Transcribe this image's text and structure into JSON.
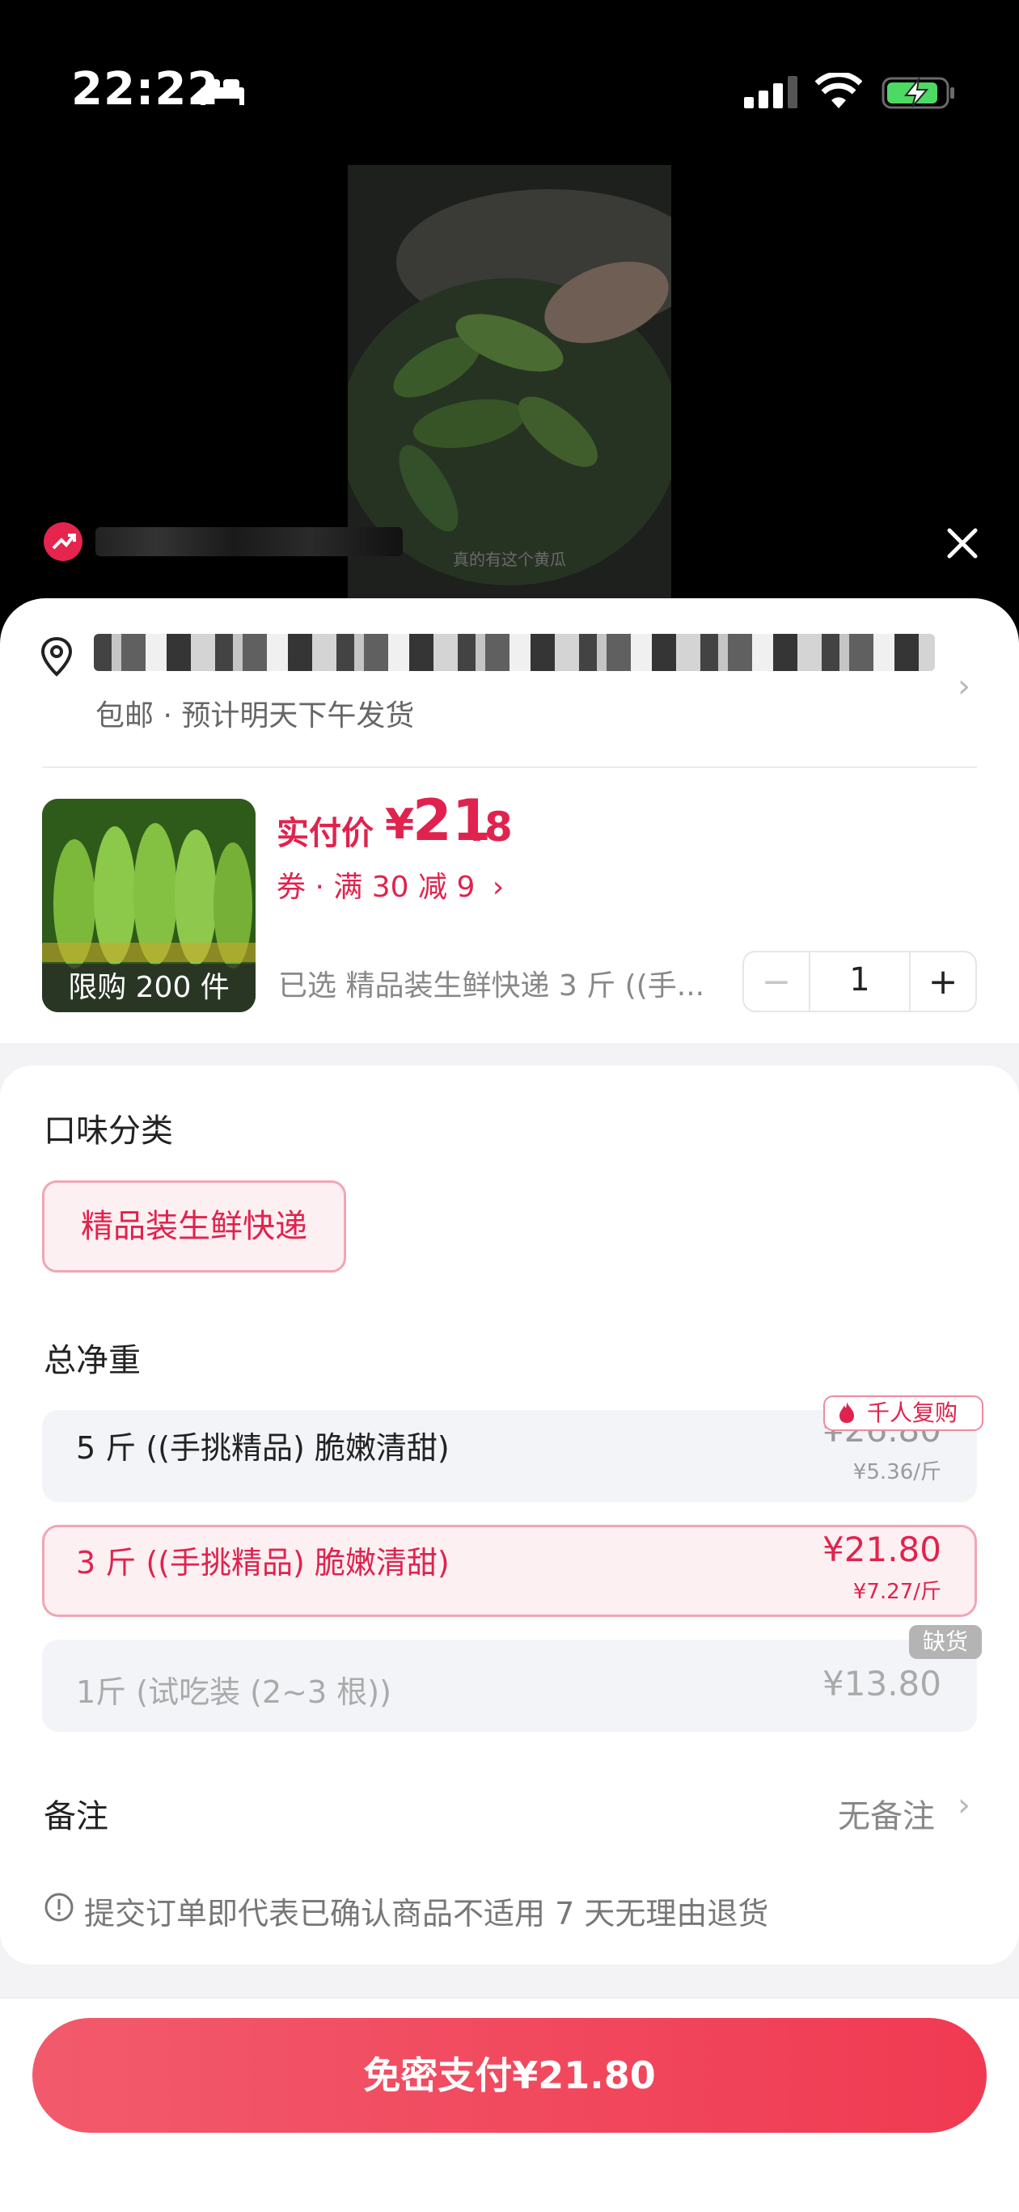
{
  "status_bar": {
    "time": "22:22"
  },
  "video": {
    "caption": "真的有这个黄瓜"
  },
  "address": {
    "shipping_note": "包邮 · 预计明天下午发货"
  },
  "product": {
    "price_label": "实付价",
    "price_symbol": "¥",
    "price_integer": "21",
    "price_decimal": ".8",
    "coupon_text": "券 · 满 30 减 9",
    "limit_text": "限购 200 件",
    "selected_text": "已选 精品装生鲜快递 3 斤 ((手...",
    "quantity": "1"
  },
  "flavor": {
    "title": "口味分类",
    "options": [
      "精品装生鲜快递"
    ]
  },
  "weight": {
    "title": "总净重",
    "options": [
      {
        "label": "5 斤 ((手挑精品) 脆嫩清甜)",
        "price": "¥26.80",
        "unit_price": "¥5.36/斤",
        "badge": "千人复购",
        "state": "normal"
      },
      {
        "label": "3 斤 ((手挑精品) 脆嫩清甜)",
        "price": "¥21.80",
        "unit_price": "¥7.27/斤",
        "state": "selected"
      },
      {
        "label": "1斤 (试吃装 (2~3 根))",
        "price": "¥13.80",
        "badge": "缺货",
        "state": "out_of_stock"
      }
    ]
  },
  "remark": {
    "title": "备注",
    "value": "无备注"
  },
  "notice": "提交订单即代表已确认商品不适用 7 天无理由退货",
  "pay_button": "免密支付¥21.80",
  "colors": {
    "accent": "#e0234e",
    "pay_gradient_start": "#f25a6c",
    "pay_gradient_end": "#f03a52",
    "chip_bg": "#fdf0f2"
  }
}
